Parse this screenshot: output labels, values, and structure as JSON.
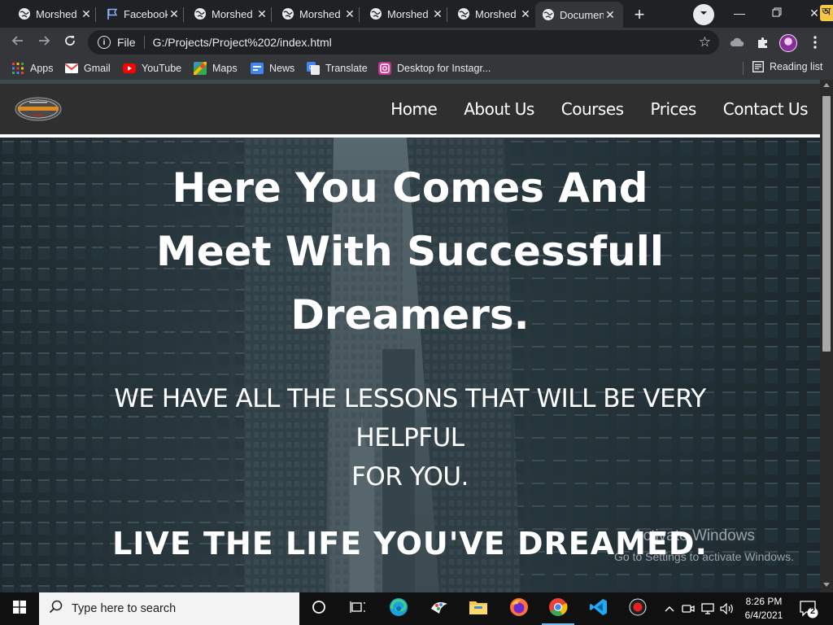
{
  "browser": {
    "tabs": [
      {
        "title": "Morshed",
        "icon": "globe-icon",
        "active": false
      },
      {
        "title": "Facebook",
        "icon": "flag-icon",
        "active": false
      },
      {
        "title": "Morshed",
        "icon": "globe-icon",
        "active": false
      },
      {
        "title": "Morshed",
        "icon": "globe-icon",
        "active": false
      },
      {
        "title": "Morshed",
        "icon": "globe-icon",
        "active": false
      },
      {
        "title": "Morshed",
        "icon": "globe-icon",
        "active": false
      },
      {
        "title": "Document",
        "icon": "globe-icon",
        "active": true
      }
    ],
    "new_tab_label": "+",
    "address": {
      "scheme_label": "File",
      "url": "G:/Projects/Project%202/index.html"
    },
    "bookmarks": [
      {
        "label": "Apps",
        "icon": "apps-grid-icon"
      },
      {
        "label": "Gmail",
        "icon": "gmail-icon"
      },
      {
        "label": "YouTube",
        "icon": "youtube-icon"
      },
      {
        "label": "Maps",
        "icon": "maps-icon"
      },
      {
        "label": "News",
        "icon": "news-icon"
      },
      {
        "label": "Translate",
        "icon": "translate-icon"
      },
      {
        "label": "Desktop for Instagr...",
        "icon": "instagram-desktop-icon"
      }
    ],
    "reading_list_label": "Reading list"
  },
  "site": {
    "nav_links": [
      "Home",
      "About Us",
      "Courses",
      "Prices",
      "Contact Us"
    ],
    "hero": {
      "title_lines": [
        "Here You Comes And",
        "Meet With Successfull",
        "Dreamers."
      ],
      "subtitle_lines": [
        "WE HAVE ALL THE LESSONS THAT WILL BE VERY HELPFUL",
        "FOR YOU."
      ],
      "tagline": "LIVE THE LIFE YOU'VE DREAMED."
    }
  },
  "os_watermark": {
    "line1": "Activate Windows",
    "line2": "Go to Settings to activate Windows."
  },
  "taskbar": {
    "search_placeholder": "Type here to search",
    "apps": [
      "task-view-icon",
      "edge-icon",
      "paint-icon",
      "file-explorer-icon",
      "firefox-icon",
      "chrome-icon",
      "vscode-icon",
      "screen-recorder-icon"
    ],
    "time": "8:26 PM",
    "date": "6/4/2021",
    "notification_count": "2"
  },
  "colors": {
    "chrome_dark": "#202124",
    "chrome_toolbar": "#35363a",
    "site_nav_bg": "#2f2f2f",
    "hero_overlay": "#3c4a52",
    "taskbar_bg": "#101010",
    "accent": "#76b9ed"
  }
}
